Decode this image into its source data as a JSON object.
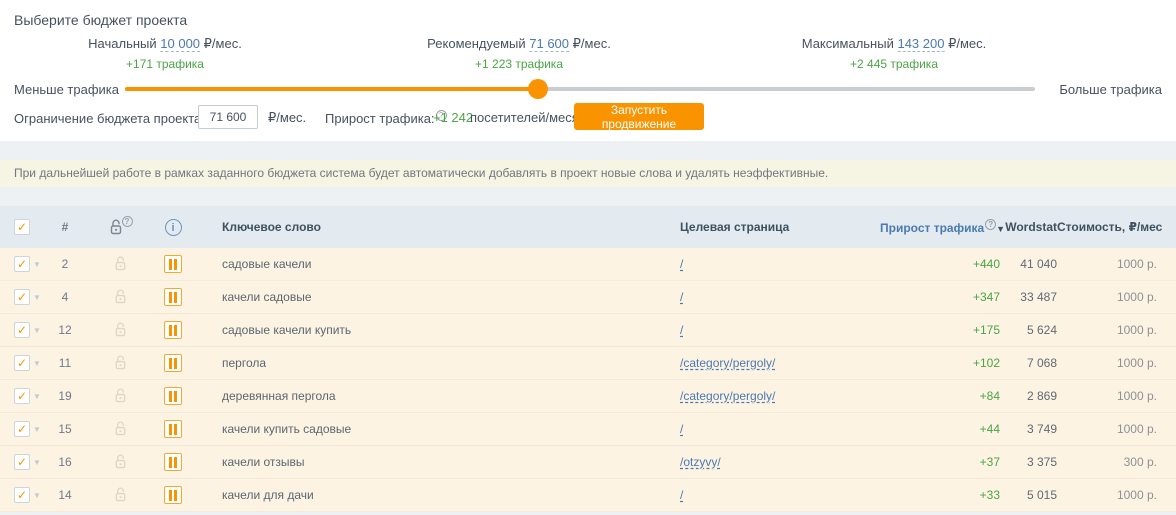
{
  "budget_section": {
    "title": "Выберите бюджет проекта",
    "options": [
      {
        "label": "Начальный",
        "amount": "10 000",
        "unit": "₽/мес.",
        "traffic": "+171 трафика"
      },
      {
        "label": "Рекомендуемый",
        "amount": "71 600",
        "unit": "₽/мес.",
        "traffic": "+1 223 трафика"
      },
      {
        "label": "Максимальный",
        "amount": "143 200",
        "unit": "₽/мес.",
        "traffic": "+2 445 трафика"
      }
    ],
    "slider": {
      "left_label": "Меньше трафика",
      "right_label": "Больше трафика",
      "position_percent": 45.4
    },
    "limit": {
      "label": "Ограничение бюджета проекта:",
      "value": "71 600",
      "unit": "₽/мес.",
      "help_icon": "?"
    },
    "growth": {
      "label": "Прирост трафика:",
      "help_icon": "?",
      "value": "+1 242",
      "suffix": "посетителей/месяц"
    },
    "start_button_label": "Запустить продвижение"
  },
  "notice_text": "При дальнейшей работе в рамках заданного бюджета система будет автоматически добавлять в проект новые слова и удалять неэффективные.",
  "table": {
    "headers": {
      "number": "#",
      "keyword": "Ключевое слово",
      "page": "Целевая страница",
      "traffic": "Прирост трафика",
      "traffic_sort": "▼",
      "wordstat": "Wordstat",
      "cost": "Стоимость, ₽/мес"
    },
    "check_glyph": "✓",
    "rows": [
      {
        "num": "2",
        "keyword": "садовые качели",
        "page": "/",
        "traffic": "+440",
        "wordstat": "41 040",
        "cost": "1000 р."
      },
      {
        "num": "4",
        "keyword": "качели садовые",
        "page": "/",
        "traffic": "+347",
        "wordstat": "33 487",
        "cost": "1000 р."
      },
      {
        "num": "12",
        "keyword": "садовые качели купить",
        "page": "/",
        "traffic": "+175",
        "wordstat": "5 624",
        "cost": "1000 р."
      },
      {
        "num": "11",
        "keyword": "пергола",
        "page": "/category/pergoly/",
        "traffic": "+102",
        "wordstat": "7 068",
        "cost": "1000 р."
      },
      {
        "num": "19",
        "keyword": "деревянная пергола",
        "page": "/category/pergoly/",
        "traffic": "+84",
        "wordstat": "2 869",
        "cost": "1000 р."
      },
      {
        "num": "15",
        "keyword": "качели купить садовые",
        "page": "/",
        "traffic": "+44",
        "wordstat": "3 749",
        "cost": "1000 р."
      },
      {
        "num": "16",
        "keyword": "качели отзывы",
        "page": "/otzyvy/",
        "traffic": "+37",
        "wordstat": "3 375",
        "cost": "300 р."
      },
      {
        "num": "14",
        "keyword": "качели для дачи",
        "page": "/",
        "traffic": "+33",
        "wordstat": "5 015",
        "cost": "1000 р."
      }
    ]
  },
  "colors": {
    "accent_orange": "#f99400",
    "traffic_green": "#4ba446",
    "link_blue": "#4a7ab0",
    "table_header_bg": "#e3ebf0",
    "row_bg": "#fdf3e3",
    "notice_bg": "#f6f4e3",
    "page_bg": "#edf1f4"
  }
}
